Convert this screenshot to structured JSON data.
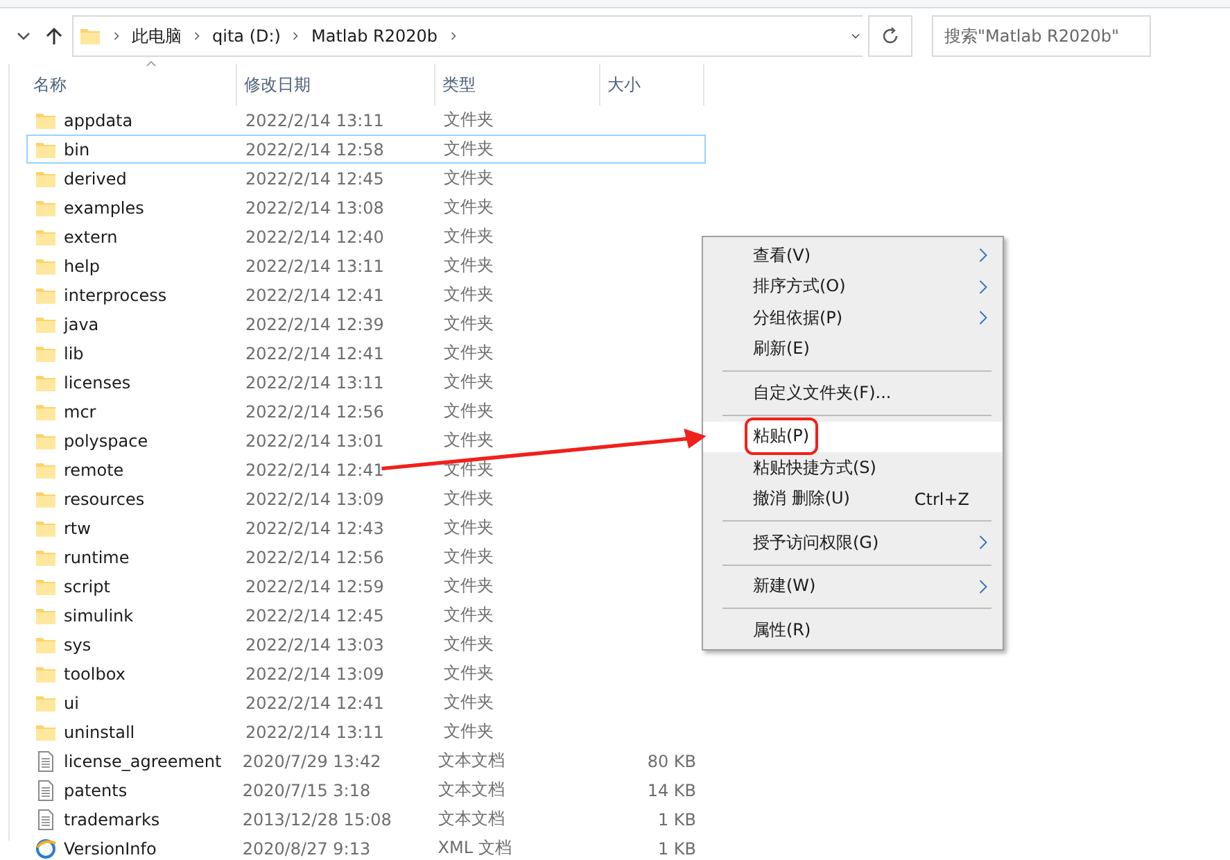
{
  "address_bar": {
    "path": [
      "此电脑",
      "qita (D:)",
      "Matlab R2020b"
    ],
    "search": {
      "placeholder": "搜索\"Matlab R2020b\""
    }
  },
  "table": {
    "columns": [
      "名称",
      "修改日期",
      "类型",
      "大小"
    ],
    "rows": [
      {
        "kind": "folder",
        "name": "appdata",
        "date": "2022/2/14 13:11",
        "type": "文件夹",
        "focused": false
      },
      {
        "kind": "folder",
        "name": "bin",
        "date": "2022/2/14 12:58",
        "type": "文件夹",
        "focused": true
      },
      {
        "kind": "folder",
        "name": "derived",
        "date": "2022/2/14 12:45",
        "type": "文件夹",
        "focused": false
      },
      {
        "kind": "folder",
        "name": "examples",
        "date": "2022/2/14 13:08",
        "type": "文件夹",
        "focused": false
      },
      {
        "kind": "folder",
        "name": "extern",
        "date": "2022/2/14 12:40",
        "type": "文件夹",
        "focused": false
      },
      {
        "kind": "folder",
        "name": "help",
        "date": "2022/2/14 13:11",
        "type": "文件夹",
        "focused": false
      },
      {
        "kind": "folder",
        "name": "interprocess",
        "date": "2022/2/14 12:41",
        "type": "文件夹",
        "focused": false
      },
      {
        "kind": "folder",
        "name": "java",
        "date": "2022/2/14 12:39",
        "type": "文件夹",
        "focused": false
      },
      {
        "kind": "folder",
        "name": "lib",
        "date": "2022/2/14 12:41",
        "type": "文件夹",
        "focused": false
      },
      {
        "kind": "folder",
        "name": "licenses",
        "date": "2022/2/14 13:11",
        "type": "文件夹",
        "focused": false
      },
      {
        "kind": "folder",
        "name": "mcr",
        "date": "2022/2/14 12:56",
        "type": "文件夹",
        "focused": false
      },
      {
        "kind": "folder",
        "name": "polyspace",
        "date": "2022/2/14 13:01",
        "type": "文件夹",
        "focused": false
      },
      {
        "kind": "folder",
        "name": "remote",
        "date": "2022/2/14 12:41",
        "type": "文件夹",
        "focused": false
      },
      {
        "kind": "folder",
        "name": "resources",
        "date": "2022/2/14 13:09",
        "type": "文件夹",
        "focused": false
      },
      {
        "kind": "folder",
        "name": "rtw",
        "date": "2022/2/14 12:43",
        "type": "文件夹",
        "focused": false
      },
      {
        "kind": "folder",
        "name": "runtime",
        "date": "2022/2/14 12:56",
        "type": "文件夹",
        "focused": false
      },
      {
        "kind": "folder",
        "name": "script",
        "date": "2022/2/14 12:59",
        "type": "文件夹",
        "focused": false
      },
      {
        "kind": "folder",
        "name": "simulink",
        "date": "2022/2/14 12:45",
        "type": "文件夹",
        "focused": false
      },
      {
        "kind": "folder",
        "name": "sys",
        "date": "2022/2/14 13:03",
        "type": "文件夹",
        "focused": false
      },
      {
        "kind": "folder",
        "name": "toolbox",
        "date": "2022/2/14 13:09",
        "type": "文件夹",
        "focused": false
      },
      {
        "kind": "folder",
        "name": "ui",
        "date": "2022/2/14 12:41",
        "type": "文件夹",
        "focused": false
      },
      {
        "kind": "folder",
        "name": "uninstall",
        "date": "2022/2/14 13:11",
        "type": "文件夹",
        "focused": false
      },
      {
        "kind": "text",
        "name": "license_agreement",
        "date": "2020/7/29 13:42",
        "type": "文本文档",
        "size": "80 KB",
        "focused": false
      },
      {
        "kind": "text",
        "name": "patents",
        "date": "2020/7/15 3:18",
        "type": "文本文档",
        "size": "14 KB",
        "focused": false
      },
      {
        "kind": "text",
        "name": "trademarks",
        "date": "2013/12/28 15:08",
        "type": "文本文档",
        "size": "1 KB",
        "focused": false
      },
      {
        "kind": "xml",
        "name": "VersionInfo",
        "date": "2020/8/27 9:13",
        "type": "XML 文档",
        "size": "1 KB",
        "focused": false
      }
    ]
  },
  "context_menu": {
    "items": [
      {
        "kind": "item",
        "label": "查看(V)",
        "submenu": true,
        "selected": false,
        "annotated": false
      },
      {
        "kind": "item",
        "label": "排序方式(O)",
        "submenu": true,
        "selected": false,
        "annotated": false
      },
      {
        "kind": "item",
        "label": "分组依据(P)",
        "submenu": true,
        "selected": false,
        "annotated": false
      },
      {
        "kind": "item",
        "label": "刷新(E)",
        "submenu": false,
        "selected": false,
        "annotated": false
      },
      {
        "kind": "separator"
      },
      {
        "kind": "item",
        "label": "自定义文件夹(F)...",
        "submenu": false,
        "selected": false,
        "annotated": false
      },
      {
        "kind": "separator"
      },
      {
        "kind": "item",
        "label": "粘贴(P)",
        "submenu": false,
        "selected": true,
        "annotated": true
      },
      {
        "kind": "item",
        "label": "粘贴快捷方式(S)",
        "submenu": false,
        "selected": false,
        "annotated": false
      },
      {
        "kind": "item",
        "label": "撤消 删除(U)",
        "shortcut": "Ctrl+Z",
        "submenu": false,
        "selected": false,
        "annotated": false
      },
      {
        "kind": "separator"
      },
      {
        "kind": "item",
        "label": "授予访问权限(G)",
        "submenu": true,
        "selected": false,
        "annotated": false
      },
      {
        "kind": "separator"
      },
      {
        "kind": "item",
        "label": "新建(W)",
        "submenu": true,
        "selected": false,
        "annotated": false
      },
      {
        "kind": "separator"
      },
      {
        "kind": "item",
        "label": "属性(R)",
        "submenu": false,
        "selected": false,
        "annotated": false
      }
    ]
  }
}
